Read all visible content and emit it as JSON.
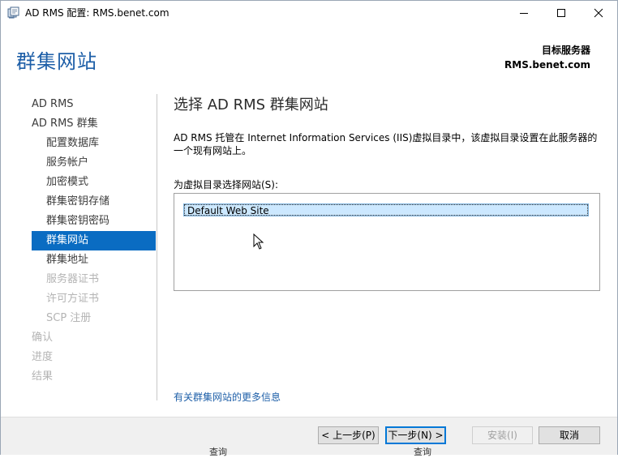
{
  "window": {
    "title": "AD RMS 配置: RMS.benet.com"
  },
  "header": {
    "page_heading": "群集网站",
    "target_label": "目标服务器",
    "target_value": "RMS.benet.com"
  },
  "nav": {
    "items": [
      {
        "label": "AD RMS",
        "level": "top",
        "state": "normal"
      },
      {
        "label": "AD RMS 群集",
        "level": "top",
        "state": "normal"
      },
      {
        "label": "配置数据库",
        "level": "sub",
        "state": "normal"
      },
      {
        "label": "服务帐户",
        "level": "sub",
        "state": "normal"
      },
      {
        "label": "加密模式",
        "level": "sub",
        "state": "normal"
      },
      {
        "label": "群集密钥存储",
        "level": "sub",
        "state": "normal"
      },
      {
        "label": "群集密钥密码",
        "level": "sub",
        "state": "normal"
      },
      {
        "label": "群集网站",
        "level": "sub",
        "state": "active"
      },
      {
        "label": "群集地址",
        "level": "sub",
        "state": "normal"
      },
      {
        "label": "服务器证书",
        "level": "sub",
        "state": "disabled"
      },
      {
        "label": "许可方证书",
        "level": "sub",
        "state": "disabled"
      },
      {
        "label": "SCP 注册",
        "level": "sub",
        "state": "disabled"
      },
      {
        "label": "确认",
        "level": "top",
        "state": "disabled"
      },
      {
        "label": "进度",
        "level": "top",
        "state": "disabled"
      },
      {
        "label": "结果",
        "level": "top",
        "state": "disabled"
      }
    ]
  },
  "content": {
    "title": "选择 AD RMS 群集网站",
    "description": "AD RMS 托管在 Internet Information Services (IIS)虚拟目录中，该虚拟目录设置在此服务器的一个现有网站上。",
    "list_label": "为虚拟目录选择网站(S):",
    "sites": [
      "Default Web Site"
    ],
    "more_link": "有关群集网站的更多信息"
  },
  "footer": {
    "prev": "< 上一步(P)",
    "next": "下一步(N) >",
    "install": "安装(I)",
    "cancel": "取消"
  },
  "background_peek": [
    "查询",
    "查询"
  ],
  "colors": {
    "accent": "#1e5fa8",
    "nav_active": "#0a6cc2",
    "disabled_text": "#b4b4b4",
    "selection": "#cce8ff"
  }
}
